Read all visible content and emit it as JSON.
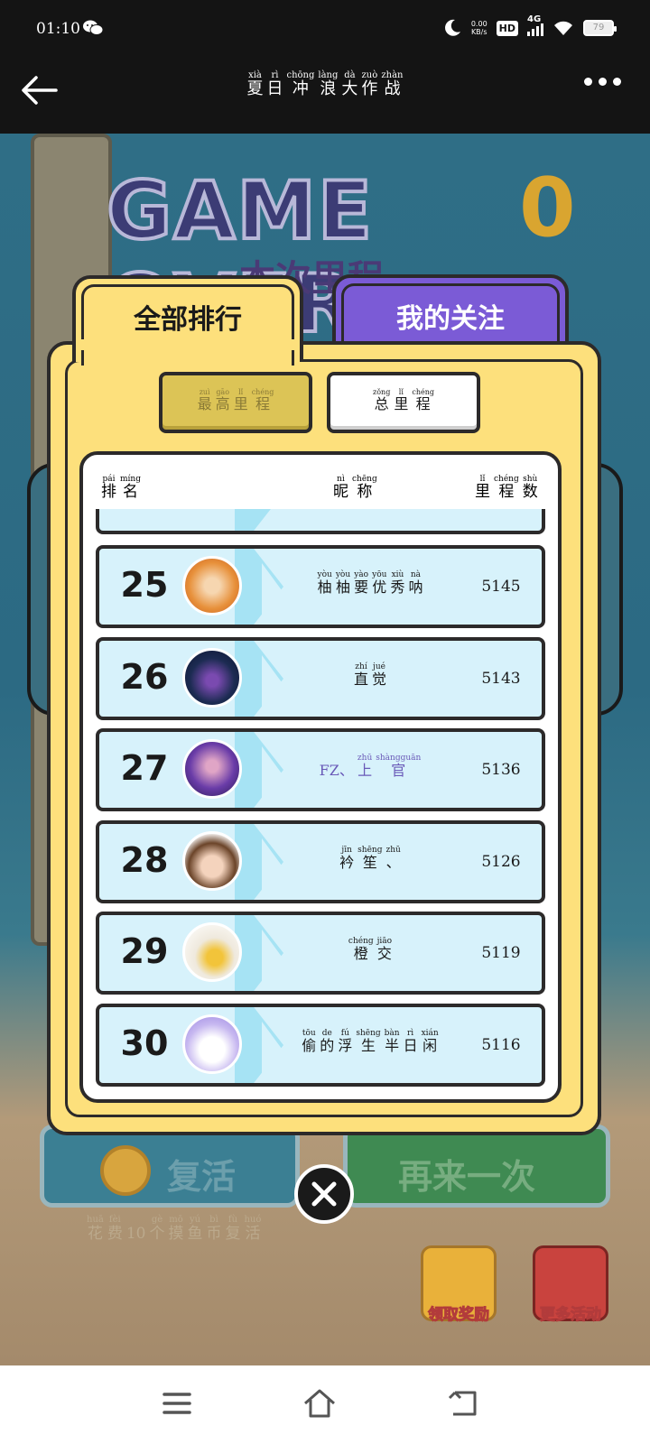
{
  "status": {
    "time": "01:10",
    "net_speed": "0.00",
    "net_unit": "KB/s",
    "hd": "HD",
    "signal_label": "4G",
    "battery": "79"
  },
  "header": {
    "title": [
      {
        "py": "xià",
        "hz": "夏"
      },
      {
        "py": "rì",
        "hz": "日"
      },
      {
        "py": "chōng",
        "hz": "冲"
      },
      {
        "py": "làng",
        "hz": "浪"
      },
      {
        "py": "dà",
        "hz": "大"
      },
      {
        "py": "zuò",
        "hz": "作"
      },
      {
        "py": "zhàn",
        "hz": "战"
      }
    ]
  },
  "game": {
    "headline": "GAME OVER",
    "subheadline": "本次里程",
    "revive_label": "复活",
    "again_label": "再来一次",
    "cost": [
      {
        "py": "huā",
        "hz": "花"
      },
      {
        "py": "fèi",
        "hz": "费"
      },
      {
        "py": "",
        "hz": "10"
      },
      {
        "py": "gè",
        "hz": "个"
      },
      {
        "py": "mō",
        "hz": "摸"
      },
      {
        "py": "yú",
        "hz": "鱼"
      },
      {
        "py": "bì",
        "hz": "币"
      },
      {
        "py": "fù",
        "hz": "复"
      },
      {
        "py": "huó",
        "hz": "活"
      }
    ],
    "reward_label": "领取奖励",
    "activity_label": "更多活动"
  },
  "tabs": {
    "all": "全部排行",
    "follow": "我的关注"
  },
  "sub_tabs": {
    "high": [
      {
        "py": "zuì",
        "hz": "最"
      },
      {
        "py": "gāo",
        "hz": "高"
      },
      {
        "py": "lǐ",
        "hz": "里"
      },
      {
        "py": "chéng",
        "hz": "程"
      }
    ],
    "total": [
      {
        "py": "zǒng",
        "hz": "总"
      },
      {
        "py": "lǐ",
        "hz": "里"
      },
      {
        "py": "chéng",
        "hz": "程"
      }
    ]
  },
  "list_header": {
    "rank": [
      {
        "py": "pái",
        "hz": "排"
      },
      {
        "py": "míng",
        "hz": "名"
      }
    ],
    "nick": [
      {
        "py": "nì",
        "hz": "昵"
      },
      {
        "py": "chēng",
        "hz": "称"
      }
    ],
    "score": [
      {
        "py": "lǐ",
        "hz": "里"
      },
      {
        "py": "chéng",
        "hz": "程"
      },
      {
        "py": "shù",
        "hz": "数"
      }
    ]
  },
  "rows": [
    {
      "rank": "25",
      "score": "5145",
      "avatar": "flower-avatar",
      "name": [
        {
          "py": "yòu",
          "hz": "柚"
        },
        {
          "py": "yòu",
          "hz": "柚"
        },
        {
          "py": "yào",
          "hz": "要"
        },
        {
          "py": "yōu",
          "hz": "优"
        },
        {
          "py": "xiù",
          "hz": "秀"
        },
        {
          "py": "nà",
          "hz": "呐"
        }
      ]
    },
    {
      "rank": "26",
      "score": "5143",
      "avatar": "hooded-figure-avatar",
      "name": [
        {
          "py": "zhí",
          "hz": "直"
        },
        {
          "py": "jué",
          "hz": "觉"
        }
      ]
    },
    {
      "rank": "27",
      "score": "5136",
      "avatar": "ninja-avatar",
      "purple": true,
      "name": [
        {
          "py": "",
          "hz": "FZ、"
        },
        {
          "py": "zhū",
          "hz": "上"
        },
        {
          "py": "shàngguān",
          "hz": "官"
        }
      ]
    },
    {
      "rank": "28",
      "score": "5126",
      "avatar": "boy-avatar",
      "name": [
        {
          "py": "jīn",
          "hz": "衿"
        },
        {
          "py": "shēng",
          "hz": "笙"
        },
        {
          "py": "zhū",
          "hz": "、"
        }
      ]
    },
    {
      "rank": "29",
      "score": "5119",
      "avatar": "pikachu-avatar",
      "name": [
        {
          "py": "chéng",
          "hz": "橙"
        },
        {
          "py": "jiāo",
          "hz": "交"
        }
      ]
    },
    {
      "rank": "30",
      "score": "5116",
      "avatar": "ghost-avatar",
      "name": [
        {
          "py": "tōu",
          "hz": "偷"
        },
        {
          "py": "de",
          "hz": "的"
        },
        {
          "py": "fú",
          "hz": "浮"
        },
        {
          "py": "shēng",
          "hz": "生"
        },
        {
          "py": "bàn",
          "hz": "半"
        },
        {
          "py": "rì",
          "hz": "日"
        },
        {
          "py": "xián",
          "hz": "闲"
        }
      ]
    }
  ]
}
